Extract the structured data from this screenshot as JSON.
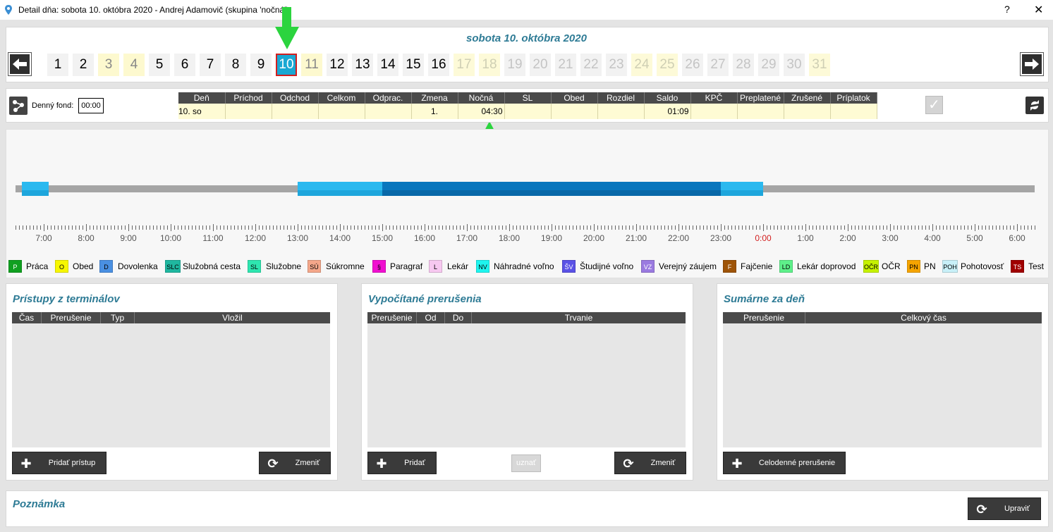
{
  "window": {
    "title": "Detail dňa: sobota 10. októbra 2020 -  Andrej Adamovič  (skupina 'nočná')",
    "help": "?",
    "close": "✕"
  },
  "header": {
    "date_title": "sobota 10. októbra 2020",
    "selected_day": 10
  },
  "days": [
    {
      "n": "1",
      "k": "wd"
    },
    {
      "n": "2",
      "k": "wd"
    },
    {
      "n": "3",
      "k": "we"
    },
    {
      "n": "4",
      "k": "we"
    },
    {
      "n": "5",
      "k": "wd"
    },
    {
      "n": "6",
      "k": "wd"
    },
    {
      "n": "7",
      "k": "wd"
    },
    {
      "n": "8",
      "k": "wd"
    },
    {
      "n": "9",
      "k": "wd"
    },
    {
      "n": "10",
      "k": "sel"
    },
    {
      "n": "11",
      "k": "we"
    },
    {
      "n": "12",
      "k": "wd"
    },
    {
      "n": "13",
      "k": "wd"
    },
    {
      "n": "14",
      "k": "wd"
    },
    {
      "n": "15",
      "k": "wd"
    },
    {
      "n": "16",
      "k": "wd"
    },
    {
      "n": "17",
      "k": "fwe"
    },
    {
      "n": "18",
      "k": "fwe"
    },
    {
      "n": "19",
      "k": "fwd"
    },
    {
      "n": "20",
      "k": "fwd"
    },
    {
      "n": "21",
      "k": "fwd"
    },
    {
      "n": "22",
      "k": "fwd"
    },
    {
      "n": "23",
      "k": "fwd"
    },
    {
      "n": "24",
      "k": "fwe"
    },
    {
      "n": "25",
      "k": "fwe"
    },
    {
      "n": "26",
      "k": "fwd"
    },
    {
      "n": "27",
      "k": "fwd"
    },
    {
      "n": "28",
      "k": "fwd"
    },
    {
      "n": "29",
      "k": "fwd"
    },
    {
      "n": "30",
      "k": "fwd"
    },
    {
      "n": "31",
      "k": "fwe"
    }
  ],
  "summary": {
    "fund_label": "Denný fond:",
    "fund_value": "00:00",
    "columns": [
      "Deň",
      "Príchod",
      "Odchod",
      "Celkom",
      "Odprac.",
      "Zmena",
      "Nočná",
      "SL",
      "Obed",
      "Rozdiel",
      "Saldo",
      "KPČ",
      "Preplatené",
      "Zrušené",
      "Príplatok"
    ],
    "row": [
      "10. so",
      "",
      "",
      "",
      "",
      "1.",
      "04:30",
      "",
      "",
      "",
      "01:09",
      "",
      "",
      "",
      ""
    ]
  },
  "timeline": {
    "labels": [
      "7:00",
      "8:00",
      "9:00",
      "10:00",
      "11:00",
      "12:00",
      "13:00",
      "14:00",
      "15:00",
      "16:00",
      "17:00",
      "18:00",
      "19:00",
      "20:00",
      "21:00",
      "22:00",
      "23:00",
      "0:00",
      "1:00",
      "2:00",
      "3:00",
      "4:00",
      "5:00",
      "6:00"
    ],
    "midnight_color": "#d21f1f",
    "segments": [
      {
        "from": "6:29",
        "to": "7:07",
        "type": "light"
      },
      {
        "from": "13:00",
        "to": "15:00",
        "type": "light"
      },
      {
        "from": "15:00",
        "to": "23:00",
        "type": "dark"
      },
      {
        "from": "23:00",
        "to": "0:00",
        "type": "light"
      }
    ]
  },
  "legend": [
    {
      "code": "P",
      "label": "Práca",
      "bg": "#10a020",
      "fg": "#fff"
    },
    {
      "code": "O",
      "label": "Obed",
      "bg": "#f7f700",
      "fg": "#000"
    },
    {
      "code": "D",
      "label": "Dovolenka",
      "bg": "#4a90e2",
      "fg": "#000"
    },
    {
      "code": "SLC",
      "label": "Služobná cesta",
      "bg": "#1fb7a0",
      "fg": "#000"
    },
    {
      "code": "SL",
      "label": "Služobne",
      "bg": "#2ee6b0",
      "fg": "#000"
    },
    {
      "code": "SÚ",
      "label": "Súkromne",
      "bg": "#f4a78a",
      "fg": "#000"
    },
    {
      "code": "§",
      "label": "Paragraf",
      "bg": "#f00fd0",
      "fg": "#000"
    },
    {
      "code": "L",
      "label": "Lekár",
      "bg": "#f7c8f0",
      "fg": "#000"
    },
    {
      "code": "NV",
      "label": "Náhradné voľno",
      "bg": "#1ef5ef",
      "fg": "#000"
    },
    {
      "code": "ŠV",
      "label": "Študijné voľno",
      "bg": "#5a52e6",
      "fg": "#fff"
    },
    {
      "code": "VZ",
      "label": "Verejný záujem",
      "bg": "#9a7ae0",
      "fg": "#fff"
    },
    {
      "code": "F",
      "label": "Fajčenie",
      "bg": "#9e5408",
      "fg": "#fff"
    },
    {
      "code": "LD",
      "label": "Lekár doprovod",
      "bg": "#5ef08a",
      "fg": "#000"
    },
    {
      "code": "OČR",
      "label": "OČR",
      "bg": "#c6f200",
      "fg": "#000"
    },
    {
      "code": "PN",
      "label": "PN",
      "bg": "#f5a400",
      "fg": "#000"
    },
    {
      "code": "POH",
      "label": "Pohotovosť",
      "bg": "#c8f0f8",
      "fg": "#000"
    },
    {
      "code": "TS",
      "label": "Test",
      "bg": "#a00000",
      "fg": "#fff"
    }
  ],
  "terminal": {
    "title": "Prístupy z terminálov",
    "cols": [
      "Čas",
      "Prerušenie",
      "Typ",
      "Vložil"
    ],
    "add": "Pridať prístup",
    "change": "Zmeniť"
  },
  "computed": {
    "title": "Vypočítané prerušenia",
    "cols": [
      "Prerušenie",
      "Od",
      "Do",
      "Trvanie"
    ],
    "add": "Pridať",
    "approve": "uznať",
    "change": "Zmeniť"
  },
  "daysum": {
    "title": "Sumárne za deň",
    "cols": [
      "Prerušenie",
      "Celkový čas"
    ],
    "fullday": "Celodenné prerušenie"
  },
  "note": {
    "title": "Poznámka",
    "edit": "Upraviť"
  }
}
